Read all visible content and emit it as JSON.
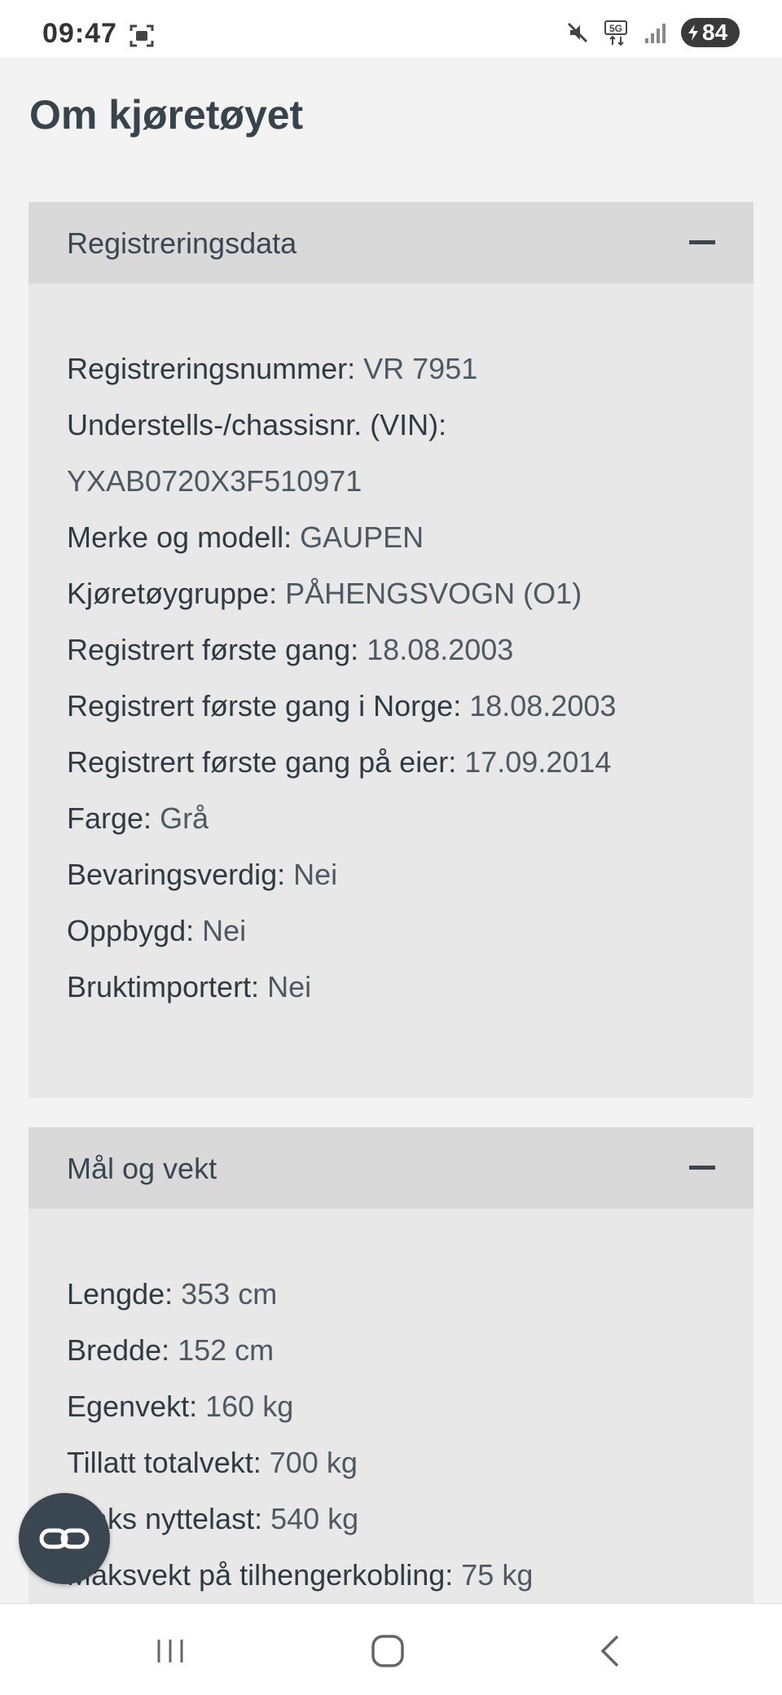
{
  "status_bar": {
    "time": "09:47",
    "battery": "84",
    "icons": [
      "screen-record-icon",
      "mute-icon",
      "5g-icon",
      "signal-icon",
      "battery-icon"
    ]
  },
  "page": {
    "title": "Om kjøretøyet"
  },
  "sections": [
    {
      "title": "Registreringsdata",
      "rows": [
        {
          "label": "Registreringsnummer:",
          "value": "VR 7951"
        },
        {
          "label": "Understells-/chassisnr. (VIN):",
          "value": "YXAB0720X3F510971"
        },
        {
          "label": "Merke og modell:",
          "value": "GAUPEN"
        },
        {
          "label": "Kjøretøygruppe:",
          "value": "PÅHENGSVOGN (O1)"
        },
        {
          "label": "Registrert første gang:",
          "value": "18.08.2003"
        },
        {
          "label": "Registrert første gang i Norge:",
          "value": "18.08.2003"
        },
        {
          "label": "Registrert første gang på eier:",
          "value": "17.09.2014"
        },
        {
          "label": "Farge:",
          "value": "Grå"
        },
        {
          "label": "Bevaringsverdig:",
          "value": "Nei"
        },
        {
          "label": "Oppbygd:",
          "value": "Nei"
        },
        {
          "label": "Bruktimportert:",
          "value": "Nei"
        }
      ]
    },
    {
      "title": "Mål og vekt",
      "rows": [
        {
          "label": "Lengde:",
          "value": "353 cm"
        },
        {
          "label": "Bredde:",
          "value": "152 cm"
        },
        {
          "label": "Egenvekt:",
          "value": "160 kg"
        },
        {
          "label": "Tillatt totalvekt:",
          "value": "700 kg"
        },
        {
          "label": "Maks nyttelast:",
          "value": "540 kg"
        },
        {
          "label": "Maksvekt på tilhengerkobling:",
          "value": "75 kg"
        }
      ]
    }
  ],
  "colors": {
    "accent": "#3a4750",
    "header_bg": "#d9d9d9",
    "section_bg": "#e8e8e8"
  }
}
